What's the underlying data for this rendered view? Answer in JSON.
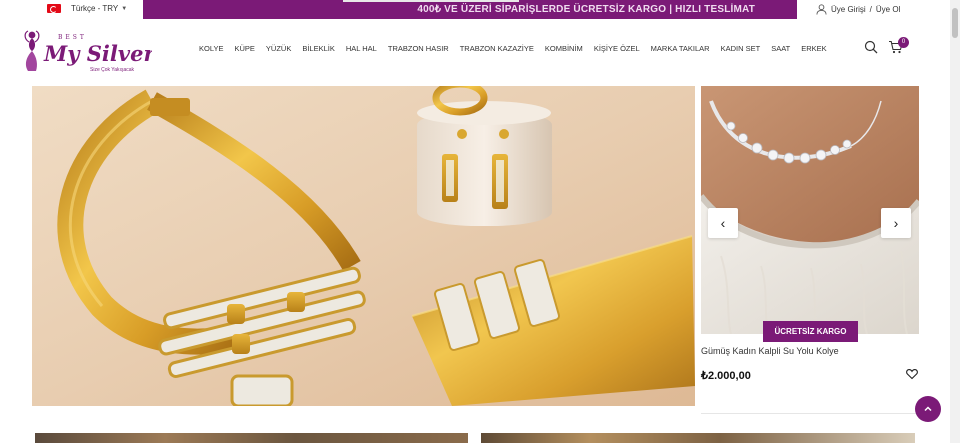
{
  "topbar": {
    "language_label": "Türkçe - TRY",
    "promo_text": "400₺ VE ÜZERİ SİPARİŞLERDE ÜCRETSİZ KARGO | HIZLI TESLİMAT",
    "login_label": "Üye Girişi",
    "separator": "/",
    "register_label": "Üye Ol",
    "flag_icon": "turkey-flag-icon"
  },
  "logo": {
    "brand": "My Silver",
    "tagline_top": "BEST",
    "slogan": "Size Çok Yakışacak"
  },
  "nav": {
    "items": [
      "KOLYE",
      "KÜPE",
      "YÜZÜK",
      "BİLEKLİK",
      "HAL HAL",
      "TRABZON HASIR",
      "TRABZON KAZAZİYE",
      "KOMBİNİM",
      "KİŞİYE ÖZEL",
      "MARKA TAKILAR",
      "KADIN SET",
      "SAAT",
      "ERKEK"
    ]
  },
  "cart": {
    "count": "0"
  },
  "product": {
    "badge": "ÜCRETSİZ KARGO",
    "name": "Gümüş Kadın Kalpli Su Yolu Kolye",
    "price": "₺2.000,00",
    "prev_icon": "‹",
    "next_icon": "›"
  },
  "colors": {
    "brand": "#7b1a77",
    "promo_text": "#f0dcef"
  },
  "icons": {
    "search": "search-icon",
    "cart": "cart-icon",
    "user": "user-icon",
    "wishlist": "heart-icon",
    "scroll_top": "chevron-up-icon"
  }
}
